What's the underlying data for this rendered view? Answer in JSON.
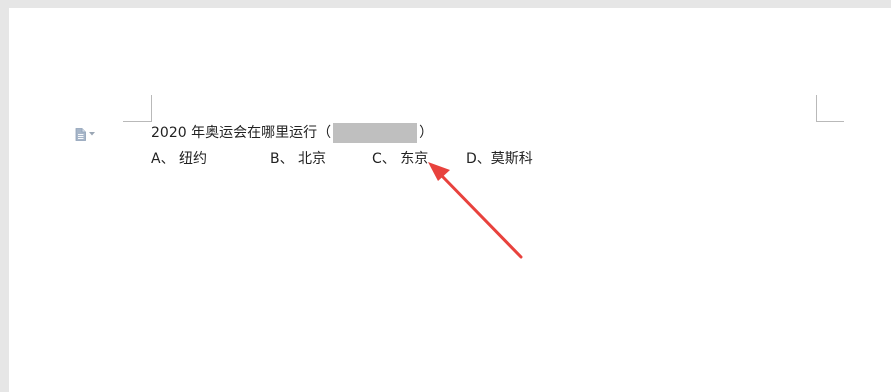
{
  "document": {
    "question_prefix": "2020 年奥运会在哪里运行（",
    "question_suffix": "）",
    "options": [
      {
        "label": "A、 纽约"
      },
      {
        "label": "B、 北京"
      },
      {
        "label": "C、 东京"
      },
      {
        "label": "D、莫斯科"
      }
    ]
  },
  "icons": {
    "paragraph_handle": "document-icon",
    "dropdown": "caret-down-icon"
  },
  "colors": {
    "arrow": "#e8423d",
    "redaction": "#bfbfbf"
  }
}
